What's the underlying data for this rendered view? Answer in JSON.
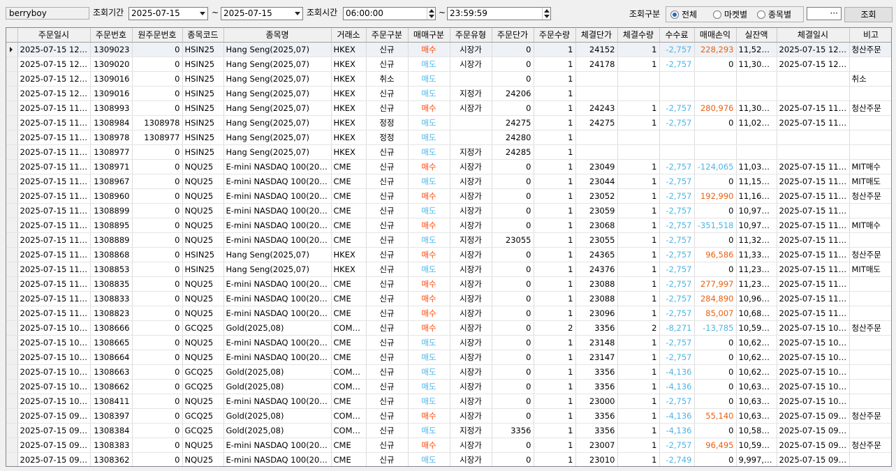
{
  "toolbar": {
    "account": "berryboy",
    "period_label": "조회기간",
    "date_from": "2025-07-15",
    "tilde1": "~",
    "date_to": "2025-07-15",
    "time_label": "조회시간",
    "time_from": "06:00:00",
    "tilde2": "~",
    "time_to": "23:59:59",
    "category_label": "조회구분",
    "radio_all": "전체",
    "radio_market": "마켓별",
    "radio_item": "종목별",
    "selected_radio": "전체",
    "code_value": "···",
    "search_button": "조회"
  },
  "colors": {
    "buy": "#ff4400",
    "sell": "#4db4e6",
    "profit": "#e86010",
    "loss": "#4db4e6"
  },
  "table": {
    "columns": [
      "주문일시",
      "주문번호",
      "원주문번호",
      "종목코드",
      "종목명",
      "거래소",
      "주문구분",
      "매매구분",
      "주문유형",
      "주문단가",
      "주문수량",
      "체결단가",
      "체결수량",
      "수수료",
      "매매손익",
      "실잔액",
      "체결일시",
      "비고"
    ],
    "rows": [
      {
        "dt": "2025-07-15 12:…",
        "no": "1309023",
        "orig": "0",
        "code": "HSIN25",
        "name": "Hang Seng(2025,07)",
        "ex": "HKEX",
        "kind": "신규",
        "side": "매수",
        "type": "시장가",
        "price": "0",
        "qty": "1",
        "fill_price": "24152",
        "fill_qty": "1",
        "fee": "-2,757",
        "pnl": "228,293",
        "bal": "11,529,…",
        "fill_dt": "2025-07-15 12:…",
        "note": "청산주문"
      },
      {
        "dt": "2025-07-15 12:…",
        "no": "1309020",
        "orig": "0",
        "code": "HSIN25",
        "name": "Hang Seng(2025,07)",
        "ex": "HKEX",
        "kind": "신규",
        "side": "매도",
        "type": "시장가",
        "price": "0",
        "qty": "1",
        "fill_price": "24178",
        "fill_qty": "1",
        "fee": "-2,757",
        "pnl": "0",
        "bal": "11,303,…",
        "fill_dt": "2025-07-15 12:…",
        "note": ""
      },
      {
        "dt": "2025-07-15 12:…",
        "no": "1309016",
        "orig": "0",
        "code": "HSIN25",
        "name": "Hang Seng(2025,07)",
        "ex": "HKEX",
        "kind": "취소",
        "side": "매도",
        "type": "",
        "price": "0",
        "qty": "1",
        "fill_price": "",
        "fill_qty": "",
        "fee": "",
        "pnl": "",
        "bal": "",
        "fill_dt": "",
        "note": "취소"
      },
      {
        "dt": "2025-07-15 12:…",
        "no": "1309016",
        "orig": "0",
        "code": "HSIN25",
        "name": "Hang Seng(2025,07)",
        "ex": "HKEX",
        "kind": "신규",
        "side": "매도",
        "type": "지정가",
        "price": "24206",
        "qty": "1",
        "fill_price": "",
        "fill_qty": "",
        "fee": "",
        "pnl": "",
        "bal": "",
        "fill_dt": "",
        "note": ""
      },
      {
        "dt": "2025-07-15 11:…",
        "no": "1308993",
        "orig": "0",
        "code": "HSIN25",
        "name": "Hang Seng(2025,07)",
        "ex": "HKEX",
        "kind": "신규",
        "side": "매수",
        "type": "시장가",
        "price": "0",
        "qty": "1",
        "fill_price": "24243",
        "fill_qty": "1",
        "fee": "-2,757",
        "pnl": "280,976",
        "bal": "11,306,…",
        "fill_dt": "2025-07-15 11:…",
        "note": "청산주문"
      },
      {
        "dt": "2025-07-15 11:…",
        "no": "1308984",
        "orig": "1308978",
        "code": "HSIN25",
        "name": "Hang Seng(2025,07)",
        "ex": "HKEX",
        "kind": "정정",
        "side": "매도",
        "type": "",
        "price": "24275",
        "qty": "1",
        "fill_price": "24275",
        "fill_qty": "1",
        "fee": "-2,757",
        "pnl": "0",
        "bal": "11,028,…",
        "fill_dt": "2025-07-15 11:…",
        "note": ""
      },
      {
        "dt": "2025-07-15 11:…",
        "no": "1308978",
        "orig": "1308977",
        "code": "HSIN25",
        "name": "Hang Seng(2025,07)",
        "ex": "HKEX",
        "kind": "정정",
        "side": "매도",
        "type": "",
        "price": "24280",
        "qty": "1",
        "fill_price": "",
        "fill_qty": "",
        "fee": "",
        "pnl": "",
        "bal": "",
        "fill_dt": "",
        "note": ""
      },
      {
        "dt": "2025-07-15 11:…",
        "no": "1308977",
        "orig": "0",
        "code": "HSIN25",
        "name": "Hang Seng(2025,07)",
        "ex": "HKEX",
        "kind": "신규",
        "side": "매도",
        "type": "지정가",
        "price": "24285",
        "qty": "1",
        "fill_price": "",
        "fill_qty": "",
        "fee": "",
        "pnl": "",
        "bal": "",
        "fill_dt": "",
        "note": ""
      },
      {
        "dt": "2025-07-15 11:…",
        "no": "1308971",
        "orig": "0",
        "code": "NQU25",
        "name": "E-mini NASDAQ 100(20…",
        "ex": "CME",
        "kind": "신규",
        "side": "매수",
        "type": "시장가",
        "price": "0",
        "qty": "1",
        "fill_price": "23049",
        "fill_qty": "1",
        "fee": "-2,757",
        "pnl": "-124,065",
        "bal": "11,031,…",
        "fill_dt": "2025-07-15 11:…",
        "note": "MIT매수"
      },
      {
        "dt": "2025-07-15 11:…",
        "no": "1308967",
        "orig": "0",
        "code": "NQU25",
        "name": "E-mini NASDAQ 100(20…",
        "ex": "CME",
        "kind": "신규",
        "side": "매도",
        "type": "시장가",
        "price": "0",
        "qty": "1",
        "fill_price": "23044",
        "fill_qty": "1",
        "fee": "-2,757",
        "pnl": "0",
        "bal": "11,157,…",
        "fill_dt": "2025-07-15 11:…",
        "note": "MIT매도"
      },
      {
        "dt": "2025-07-15 11:…",
        "no": "1308960",
        "orig": "0",
        "code": "NQU25",
        "name": "E-mini NASDAQ 100(20…",
        "ex": "CME",
        "kind": "신규",
        "side": "매수",
        "type": "시장가",
        "price": "0",
        "qty": "1",
        "fill_price": "23052",
        "fill_qty": "1",
        "fee": "-2,757",
        "pnl": "192,990",
        "bal": "11,160,…",
        "fill_dt": "2025-07-15 11:…",
        "note": "청산주문"
      },
      {
        "dt": "2025-07-15 11:…",
        "no": "1308899",
        "orig": "0",
        "code": "NQU25",
        "name": "E-mini NASDAQ 100(20…",
        "ex": "CME",
        "kind": "신규",
        "side": "매도",
        "type": "시장가",
        "price": "0",
        "qty": "1",
        "fill_price": "23059",
        "fill_qty": "1",
        "fee": "-2,757",
        "pnl": "0",
        "bal": "10,970,…",
        "fill_dt": "2025-07-15 11:…",
        "note": ""
      },
      {
        "dt": "2025-07-15 11:…",
        "no": "1308895",
        "orig": "0",
        "code": "NQU25",
        "name": "E-mini NASDAQ 100(20…",
        "ex": "CME",
        "kind": "신규",
        "side": "매수",
        "type": "시장가",
        "price": "0",
        "qty": "1",
        "fill_price": "23068",
        "fill_qty": "1",
        "fee": "-2,757",
        "pnl": "-351,518",
        "bal": "10,973,…",
        "fill_dt": "2025-07-15 11:…",
        "note": "MIT매수"
      },
      {
        "dt": "2025-07-15 11:…",
        "no": "1308889",
        "orig": "0",
        "code": "NQU25",
        "name": "E-mini NASDAQ 100(20…",
        "ex": "CME",
        "kind": "신규",
        "side": "매도",
        "type": "지정가",
        "price": "23055",
        "qty": "1",
        "fill_price": "23055",
        "fill_qty": "1",
        "fee": "-2,757",
        "pnl": "0",
        "bal": "11,327,…",
        "fill_dt": "2025-07-15 11:…",
        "note": ""
      },
      {
        "dt": "2025-07-15 11:…",
        "no": "1308868",
        "orig": "0",
        "code": "HSIN25",
        "name": "Hang Seng(2025,07)",
        "ex": "HKEX",
        "kind": "신규",
        "side": "매수",
        "type": "시장가",
        "price": "0",
        "qty": "1",
        "fill_price": "24365",
        "fill_qty": "1",
        "fee": "-2,757",
        "pnl": "96,586",
        "bal": "11,330,…",
        "fill_dt": "2025-07-15 11:…",
        "note": "청산주문"
      },
      {
        "dt": "2025-07-15 11:…",
        "no": "1308853",
        "orig": "0",
        "code": "HSIN25",
        "name": "Hang Seng(2025,07)",
        "ex": "HKEX",
        "kind": "신규",
        "side": "매도",
        "type": "시장가",
        "price": "0",
        "qty": "1",
        "fill_price": "24376",
        "fill_qty": "1",
        "fee": "-2,757",
        "pnl": "0",
        "bal": "11,236,…",
        "fill_dt": "2025-07-15 11:…",
        "note": "MIT매도"
      },
      {
        "dt": "2025-07-15 11:…",
        "no": "1308835",
        "orig": "0",
        "code": "NQU25",
        "name": "E-mini NASDAQ 100(20…",
        "ex": "CME",
        "kind": "신규",
        "side": "매수",
        "type": "시장가",
        "price": "0",
        "qty": "1",
        "fill_price": "23088",
        "fill_qty": "1",
        "fee": "-2,757",
        "pnl": "277,997",
        "bal": "11,239,…",
        "fill_dt": "2025-07-15 11:…",
        "note": ""
      },
      {
        "dt": "2025-07-15 11:…",
        "no": "1308833",
        "orig": "0",
        "code": "NQU25",
        "name": "E-mini NASDAQ 100(20…",
        "ex": "CME",
        "kind": "신규",
        "side": "매수",
        "type": "시장가",
        "price": "0",
        "qty": "1",
        "fill_price": "23088",
        "fill_qty": "1",
        "fee": "-2,757",
        "pnl": "284,890",
        "bal": "10,963,…",
        "fill_dt": "2025-07-15 11:…",
        "note": ""
      },
      {
        "dt": "2025-07-15 11:…",
        "no": "1308823",
        "orig": "0",
        "code": "NQU25",
        "name": "E-mini NASDAQ 100(20…",
        "ex": "CME",
        "kind": "신규",
        "side": "매수",
        "type": "시장가",
        "price": "0",
        "qty": "1",
        "fill_price": "23096",
        "fill_qty": "1",
        "fee": "-2,757",
        "pnl": "85,007",
        "bal": "10,681,…",
        "fill_dt": "2025-07-15 11:…",
        "note": ""
      },
      {
        "dt": "2025-07-15 10:…",
        "no": "1308666",
        "orig": "0",
        "code": "GCQ25",
        "name": "Gold(2025,08)",
        "ex": "COM…",
        "kind": "신규",
        "side": "매수",
        "type": "시장가",
        "price": "0",
        "qty": "2",
        "fill_price": "3356",
        "fill_qty": "2",
        "fee": "-8,271",
        "pnl": "-13,785",
        "bal": "10,599,…",
        "fill_dt": "2025-07-15 10:…",
        "note": "청산주문"
      },
      {
        "dt": "2025-07-15 10:…",
        "no": "1308665",
        "orig": "0",
        "code": "NQU25",
        "name": "E-mini NASDAQ 100(20…",
        "ex": "CME",
        "kind": "신규",
        "side": "매도",
        "type": "시장가",
        "price": "0",
        "qty": "1",
        "fill_price": "23148",
        "fill_qty": "1",
        "fee": "-2,757",
        "pnl": "0",
        "bal": "10,621,…",
        "fill_dt": "2025-07-15 10:…",
        "note": ""
      },
      {
        "dt": "2025-07-15 10:…",
        "no": "1308664",
        "orig": "0",
        "code": "NQU25",
        "name": "E-mini NASDAQ 100(20…",
        "ex": "CME",
        "kind": "신규",
        "side": "매도",
        "type": "시장가",
        "price": "0",
        "qty": "1",
        "fill_price": "23147",
        "fill_qty": "1",
        "fee": "-2,757",
        "pnl": "0",
        "bal": "10,624,…",
        "fill_dt": "2025-07-15 10:…",
        "note": ""
      },
      {
        "dt": "2025-07-15 10:…",
        "no": "1308663",
        "orig": "0",
        "code": "GCQ25",
        "name": "Gold(2025,08)",
        "ex": "COM…",
        "kind": "신규",
        "side": "매도",
        "type": "시장가",
        "price": "0",
        "qty": "1",
        "fill_price": "3356",
        "fill_qty": "1",
        "fee": "-4,136",
        "pnl": "0",
        "bal": "10,627,…",
        "fill_dt": "2025-07-15 10:…",
        "note": ""
      },
      {
        "dt": "2025-07-15 10:…",
        "no": "1308662",
        "orig": "0",
        "code": "GCQ25",
        "name": "Gold(2025,08)",
        "ex": "COM…",
        "kind": "신규",
        "side": "매도",
        "type": "시장가",
        "price": "0",
        "qty": "1",
        "fill_price": "3356",
        "fill_qty": "1",
        "fee": "-4,136",
        "pnl": "0",
        "bal": "10,631,…",
        "fill_dt": "2025-07-15 10:…",
        "note": ""
      },
      {
        "dt": "2025-07-15 10:…",
        "no": "1308411",
        "orig": "0",
        "code": "NQU25",
        "name": "E-mini NASDAQ 100(20…",
        "ex": "CME",
        "kind": "신규",
        "side": "매도",
        "type": "시장가",
        "price": "0",
        "qty": "1",
        "fill_price": "23000",
        "fill_qty": "1",
        "fee": "-2,757",
        "pnl": "0",
        "bal": "10,635,…",
        "fill_dt": "2025-07-15 10:…",
        "note": ""
      },
      {
        "dt": "2025-07-15 09:…",
        "no": "1308397",
        "orig": "0",
        "code": "GCQ25",
        "name": "Gold(2025,08)",
        "ex": "COM…",
        "kind": "신규",
        "side": "매수",
        "type": "시장가",
        "price": "0",
        "qty": "1",
        "fill_price": "3356",
        "fill_qty": "1",
        "fee": "-4,136",
        "pnl": "55,140",
        "bal": "10,638,…",
        "fill_dt": "2025-07-15 09:…",
        "note": "청산주문"
      },
      {
        "dt": "2025-07-15 09:…",
        "no": "1308384",
        "orig": "0",
        "code": "GCQ25",
        "name": "Gold(2025,08)",
        "ex": "COM…",
        "kind": "신규",
        "side": "매도",
        "type": "지정가",
        "price": "3356",
        "qty": "1",
        "fill_price": "3356",
        "fill_qty": "1",
        "fee": "-4,136",
        "pnl": "0",
        "bal": "10,587,…",
        "fill_dt": "2025-07-15 09:…",
        "note": ""
      },
      {
        "dt": "2025-07-15 09:…",
        "no": "1308383",
        "orig": "0",
        "code": "NQU25",
        "name": "E-mini NASDAQ 100(20…",
        "ex": "CME",
        "kind": "신규",
        "side": "매수",
        "type": "시장가",
        "price": "0",
        "qty": "1",
        "fill_price": "23007",
        "fill_qty": "1",
        "fee": "-2,757",
        "pnl": "96,495",
        "bal": "10,591,…",
        "fill_dt": "2025-07-15 09:…",
        "note": "청산주문"
      },
      {
        "dt": "2025-07-15 09:…",
        "no": "1308362",
        "orig": "0",
        "code": "NQU25",
        "name": "E-mini NASDAQ 100(20…",
        "ex": "CME",
        "kind": "신규",
        "side": "매도",
        "type": "시장가",
        "price": "0",
        "qty": "1",
        "fill_price": "23010",
        "fill_qty": "1",
        "fee": "-2,749",
        "pnl": "0",
        "bal": "9,997,542",
        "fill_dt": "2025-07-15 09:…",
        "note": ""
      }
    ]
  }
}
